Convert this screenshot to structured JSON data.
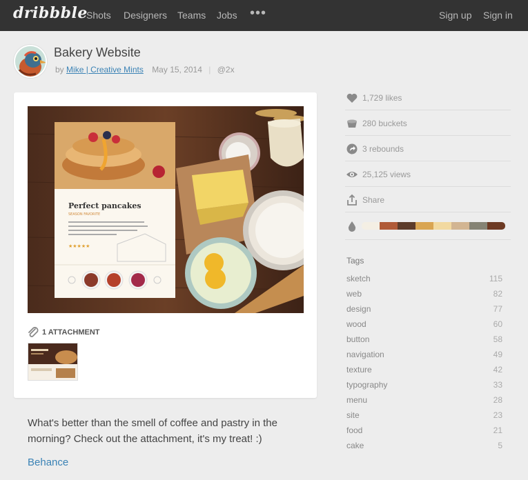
{
  "nav": {
    "logo": "dribbble",
    "items": [
      "Shots",
      "Designers",
      "Teams",
      "Jobs"
    ],
    "more": "•••",
    "signup": "Sign up",
    "signin": "Sign in"
  },
  "shot": {
    "title": "Bakery Website",
    "by": "by",
    "author": "Mike | Creative Mints",
    "date": "May 15, 2014",
    "separator": "|",
    "retina": "@2x",
    "image": {
      "card_title": "Perfect pancakes",
      "card_subtitle": "SEASON FAVORITE",
      "card_body": "Phasellus facilisis lectus non erat consequat, sed. Id interdum leo tempor. Tincidunt elit non placerat est pellentesque.",
      "stars": "★★★★★"
    },
    "attachments_label": "1 ATTACHMENT",
    "description": "What's better than the smell of coffee and pastry in the morning? Check out the attachment, it's my treat! :)",
    "link": "Behance"
  },
  "stats": {
    "likes": "1,729 likes",
    "buckets": "280 buckets",
    "rebounds": "3 rebounds",
    "views": "25,125 views",
    "share": "Share"
  },
  "palette": [
    "#f4efe4",
    "#b05a37",
    "#5c3b2a",
    "#d9a552",
    "#f2d9a0",
    "#d2b592",
    "#858374",
    "#6d3a24"
  ],
  "tags_title": "Tags",
  "tags": [
    {
      "name": "sketch",
      "count": "115"
    },
    {
      "name": "web",
      "count": "82"
    },
    {
      "name": "design",
      "count": "77"
    },
    {
      "name": "wood",
      "count": "60"
    },
    {
      "name": "button",
      "count": "58"
    },
    {
      "name": "navigation",
      "count": "49"
    },
    {
      "name": "texture",
      "count": "42"
    },
    {
      "name": "typography",
      "count": "33"
    },
    {
      "name": "menu",
      "count": "28"
    },
    {
      "name": "site",
      "count": "23"
    },
    {
      "name": "food",
      "count": "21"
    },
    {
      "name": "cake",
      "count": "5"
    }
  ],
  "colors": {
    "topbar": "#333333",
    "link": "#3a82b5",
    "background": "#ededed"
  }
}
